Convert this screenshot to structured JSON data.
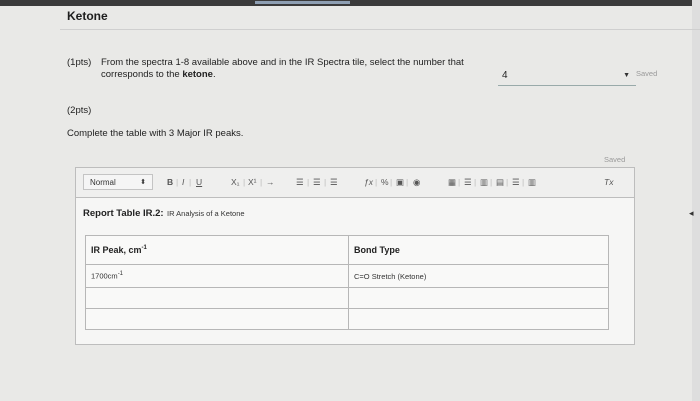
{
  "section": {
    "title": "Ketone"
  },
  "question1": {
    "points": "(1pts)",
    "text_before": "From the spectra 1-8 available above and in the IR Spectra tile, select the number that corresponds to the ",
    "text_bold": "ketone",
    "text_after": ".",
    "answer": "4",
    "saved": "Saved"
  },
  "question2": {
    "points": "(2pts)",
    "instruction": "Complete the table with 3 Major IR peaks.",
    "saved": "Saved"
  },
  "editor": {
    "toolbar": {
      "format": "Normal",
      "format_caret": "⬍",
      "bold": "B",
      "italic": "I",
      "underline": "U",
      "subscript": "X₁",
      "superscript": "X¹",
      "arrow": "→",
      "ordered_list": "☰",
      "unordered_list": "☰",
      "align": "☰",
      "formula": "ƒx",
      "link": "%",
      "image": "▣",
      "media": "◉",
      "table": "▦",
      "table_row": "☰",
      "table_col": "▥",
      "table_delete": "▤",
      "table_props": "☰",
      "table_merge": "▥",
      "clear_format": "Tx"
    },
    "report_heading": "Report Table IR.2:",
    "report_subtitle": "IR Analysis of a Ketone",
    "table": {
      "headers": {
        "peak_prefix": "IR Peak, cm",
        "peak_sup": "-1",
        "bond": "Bond Type"
      },
      "rows": [
        {
          "peak_prefix": "1700cm",
          "peak_sup": "-1",
          "bond": "C=O Stretch (Ketone)"
        },
        {
          "peak_prefix": "",
          "peak_sup": "",
          "bond": ""
        },
        {
          "peak_prefix": "",
          "peak_sup": "",
          "bond": ""
        }
      ]
    }
  }
}
